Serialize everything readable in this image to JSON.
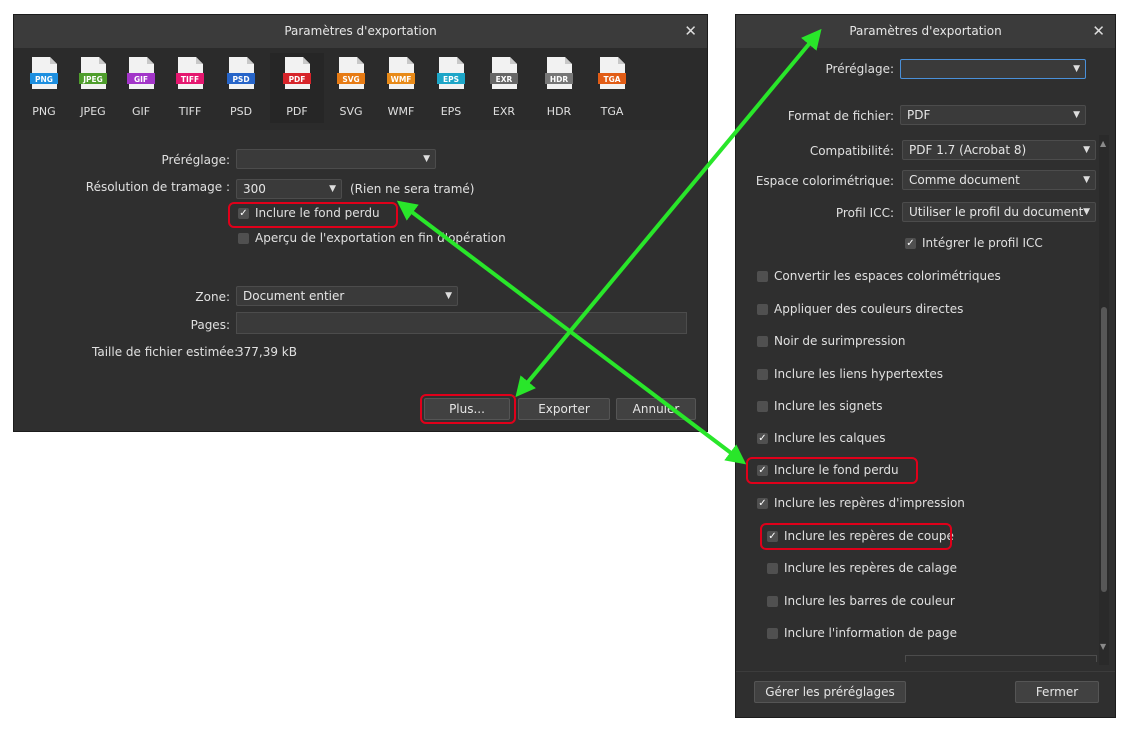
{
  "left_dialog": {
    "title": "Paramètres d'exportation",
    "close_glyph": "✕",
    "formats": [
      {
        "label": "PNG",
        "badge": "PNG",
        "color": "#1d8fe0"
      },
      {
        "label": "JPEG",
        "badge": "JPEG",
        "color": "#4f9e2c"
      },
      {
        "label": "GIF",
        "badge": "GIF",
        "color": "#a335c9"
      },
      {
        "label": "TIFF",
        "badge": "TIFF",
        "color": "#e5176f"
      },
      {
        "label": "PSD",
        "badge": "PSD",
        "color": "#2765c9"
      },
      {
        "label": "PDF",
        "badge": "PDF",
        "color": "#d7242a"
      },
      {
        "label": "SVG",
        "badge": "SVG",
        "color": "#e77b14"
      },
      {
        "label": "WMF",
        "badge": "WMF",
        "color": "#e88a18"
      },
      {
        "label": "EPS",
        "badge": "EPS",
        "color": "#1da6c8"
      },
      {
        "label": "EXR",
        "badge": "EXR",
        "color": "#676767"
      },
      {
        "label": "HDR",
        "badge": "HDR",
        "color": "#777777"
      },
      {
        "label": "TGA",
        "badge": "TGA",
        "color": "#e25d16"
      }
    ],
    "preset_label": "Préréglage:",
    "preset_value": "",
    "raster_label": "Résolution de tramage :",
    "raster_value": "300",
    "raster_note": "(Rien ne sera tramé)",
    "include_bleed": "Inclure le fond perdu",
    "preview_after": "Aperçu de l'exportation en fin d'opération",
    "area_label": "Zone:",
    "area_value": "Document entier",
    "pages_label": "Pages:",
    "pages_value": "",
    "filesize_label": "Taille de fichier estimée:",
    "filesize_value": "377,39 kB",
    "more_button": "Plus...",
    "export_button": "Exporter",
    "cancel_button": "Annuler"
  },
  "right_dialog": {
    "title": "Paramètres d'exportation",
    "close_glyph": "✕",
    "preset_label": "Préréglage:",
    "preset_value": "",
    "format_label": "Format de fichier:",
    "format_value": "PDF",
    "compat_label": "Compatibilité:",
    "compat_value": "PDF 1.7 (Acrobat 8)",
    "colorspace_label": "Espace colorimétrique:",
    "colorspace_value": "Comme document",
    "icc_label": "Profil ICC:",
    "icc_value": "Utiliser le profil du document",
    "embed_icc": "Intégrer le profil ICC",
    "convert_spaces": "Convertir les espaces colorimétriques",
    "spot_colors": "Appliquer des couleurs directes",
    "overprint_black": "Noir de surimpression",
    "hyperlinks": "Inclure les liens hypertextes",
    "bookmarks": "Inclure les signets",
    "layers": "Inclure les calques",
    "bleed": "Inclure le fond perdu",
    "print_marks": "Inclure les repères d'impression",
    "crop_marks": "Inclure les repères de coupe",
    "reg_marks": "Inclure les repères de calage",
    "color_bars": "Inclure les barres de couleur",
    "page_info": "Inclure l'information de page",
    "manage_presets": "Gérer les préréglages",
    "close_button": "Fermer"
  },
  "colors": {
    "dialog_bg": "#2f2f2f",
    "highlight": "#e0001a",
    "arrow": "#29e62a"
  }
}
